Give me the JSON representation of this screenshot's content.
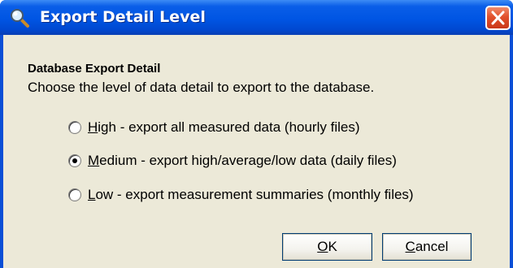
{
  "window": {
    "title": "Export Detail Level"
  },
  "content": {
    "heading": "Database Export Detail",
    "description": "Choose the level of data detail to export to the database."
  },
  "options": [
    {
      "mnemonic": "H",
      "rest": "igh - export all measured data (hourly files)",
      "selected": false
    },
    {
      "mnemonic": "M",
      "rest": "edium - export high/average/low data (daily files)",
      "selected": true
    },
    {
      "mnemonic": "L",
      "rest": "ow - export measurement summaries (monthly files)",
      "selected": false
    }
  ],
  "buttons": {
    "ok_mnemonic": "O",
    "ok_rest": "K",
    "cancel_mnemonic": "C",
    "cancel_rest": "ancel"
  },
  "colors": {
    "titlebar": "#0055e3",
    "client": "#ece9d8",
    "close": "#e2512c"
  },
  "icons": {
    "title": "magnifier-icon",
    "close": "close-icon"
  }
}
